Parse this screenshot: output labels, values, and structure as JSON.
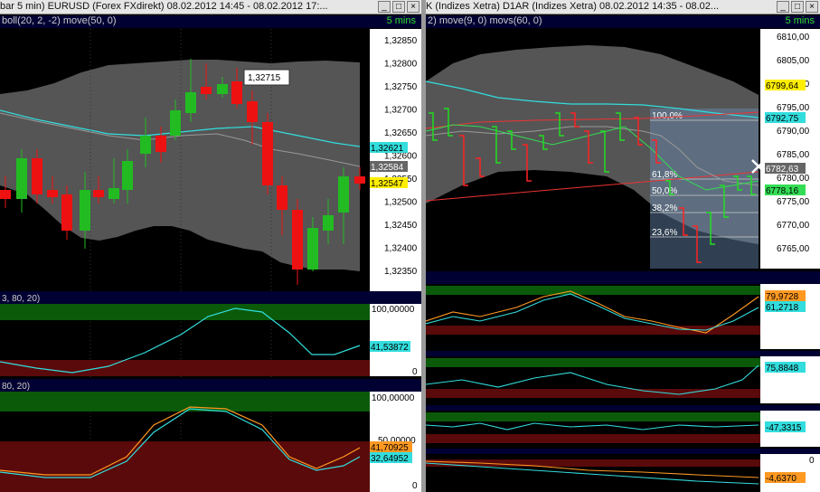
{
  "left_window": {
    "title": "bar 5 min)  EURUSD (Forex FXdirekt) 08.02.2012 14:45 - 08.02.2012 17:...",
    "main_header": "boll(20, 2, -2) move(50, 0)",
    "timeframe": "5 mins",
    "price_axis": [
      "1,32850",
      "1,32800",
      "1,32750",
      "1,32700",
      "1,32650",
      "1,32600",
      "1,32550",
      "1,32500",
      "1,32450",
      "1,32400",
      "1,32350"
    ],
    "tooltip": "1,32715",
    "tags": {
      "cyan": "1,32621",
      "gray": "1,32584",
      "yellow": "1,32547"
    },
    "ind1_header": "3, 80, 20)",
    "ind1_axis": [
      "100,00000",
      "0"
    ],
    "ind1_tag": "41,53872",
    "ind2_header": "80, 20)",
    "ind2_axis": [
      "100,00000",
      "50,00000",
      "0"
    ],
    "ind2_tags": {
      "orange": "41,70925",
      "cyan": "32,64952"
    }
  },
  "right_window": {
    "title": "K (Indizes Xetra) D1AR (Indizes Xetra) 08.02.2012 14:35 - 08.02...",
    "main_header": "2) move(9, 0) movs(60, 0)",
    "timeframe": "5 mins",
    "price_axis": [
      "6810,00",
      "6805,00",
      "6800,00",
      "6795,00",
      "6790,00",
      "6785,00",
      "6780,00",
      "6775,00",
      "6770,00",
      "6765,00"
    ],
    "fib_labels": [
      "100,0%",
      "61,8%",
      "50,0%",
      "38,2%",
      "23,6%"
    ],
    "tags": {
      "yellow": "6799,64",
      "cyan": "6792,75",
      "gray": "6782,63",
      "green": "6778,16"
    },
    "ind1_tags": {
      "orange": "79,9728",
      "cyan": "61,2718"
    },
    "ind2_tag": "75,8848",
    "ind3_tag": "-47,3315",
    "ind4_axis": "0",
    "ind4_tag": "-4,6370"
  },
  "colors": {
    "up": "#22bb22",
    "down": "#ee1111",
    "band": "#555555",
    "cyan": "#33dddd",
    "orange": "#ff9922"
  },
  "icons": {
    "minimize": "minimize-icon",
    "maximize": "maximize-icon",
    "close": "close-icon",
    "crosshair": "x-marker-icon"
  }
}
